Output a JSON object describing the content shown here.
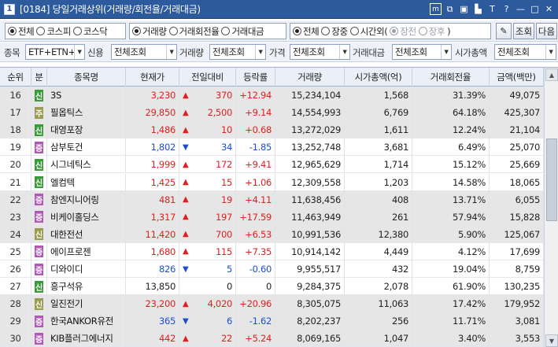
{
  "window": {
    "number": "1",
    "title": "[0184] 당일거래상위(거래량/회전율/거래대금)",
    "icons": [
      "m-icon",
      "restore-icon",
      "tile-icon",
      "pin-icon",
      "text-icon",
      "help-icon",
      "minimize-icon",
      "maximize-icon",
      "close-icon"
    ]
  },
  "filter1": {
    "market": {
      "options": [
        "전체",
        "코스피",
        "코스닥"
      ],
      "selected": 0
    },
    "sort": {
      "options": [
        "거래량",
        "거래회전율",
        "거래대금"
      ],
      "selected": 0
    },
    "session": {
      "options": [
        "전체",
        "장중",
        "시간외("
      ],
      "selected": 0
    },
    "after_hours": {
      "options": [
        "장전",
        "장후"
      ],
      "close_paren": ")",
      "selected": 0
    },
    "query_label": "조회",
    "next_label": "다음"
  },
  "filter2": {
    "item_label": "종목",
    "item_value": "ETF+ETN+스",
    "credit_label": "신용",
    "credit_value": "전체조회",
    "volume_label": "거래량",
    "volume_value": "전체조회",
    "price_label": "가격",
    "price_value": "전체조회",
    "amount_label": "거래대금",
    "amount_value": "전체조회",
    "cap_label": "시가총액",
    "cap_value": "전체조회"
  },
  "table": {
    "headers": {
      "rank": "순위",
      "type": "분",
      "name": "종목명",
      "price": "현재가",
      "change": "전일대비",
      "rate": "등락률",
      "volume": "거래량",
      "mktcap": "시가총액(억)",
      "turnover": "거래회전율",
      "amount": "금액(백만)"
    },
    "rows": [
      {
        "rank": "16",
        "badge": "신",
        "badge_color": "green",
        "name": "3S",
        "price": "3,230",
        "dir": "up",
        "change": "370",
        "rate": "+12.94",
        "volume": "15,234,104",
        "mktcap": "1,568",
        "turnover": "31.39%",
        "amount": "49,075",
        "shaded": true
      },
      {
        "rank": "17",
        "badge": "주",
        "badge_color": "olive",
        "name": "필옵틱스",
        "price": "29,850",
        "dir": "up",
        "change": "2,500",
        "rate": "+9.14",
        "volume": "14,554,993",
        "mktcap": "6,769",
        "turnover": "64.18%",
        "amount": "425,307",
        "shaded": true
      },
      {
        "rank": "18",
        "badge": "신",
        "badge_color": "green",
        "name": "대영포장",
        "price": "1,486",
        "dir": "up",
        "change": "10",
        "rate": "+0.68",
        "volume": "13,272,029",
        "mktcap": "1,611",
        "turnover": "12.24%",
        "amount": "21,104",
        "shaded": true
      },
      {
        "rank": "19",
        "badge": "증",
        "badge_color": "purple",
        "name": "삼부토건",
        "price": "1,802",
        "dir": "dn",
        "change": "34",
        "rate": "-1.85",
        "volume": "13,252,748",
        "mktcap": "3,681",
        "turnover": "6.49%",
        "amount": "25,070",
        "shaded": false
      },
      {
        "rank": "20",
        "badge": "신",
        "badge_color": "green",
        "name": "시그네틱스",
        "price": "1,999",
        "dir": "up",
        "change": "172",
        "rate": "+9.41",
        "volume": "12,965,629",
        "mktcap": "1,714",
        "turnover": "15.12%",
        "amount": "25,669",
        "shaded": false
      },
      {
        "rank": "21",
        "badge": "신",
        "badge_color": "green",
        "name": "엘컴텍",
        "price": "1,425",
        "dir": "up",
        "change": "15",
        "rate": "+1.06",
        "volume": "12,309,558",
        "mktcap": "1,203",
        "turnover": "14.58%",
        "amount": "18,065",
        "shaded": false
      },
      {
        "rank": "22",
        "badge": "증",
        "badge_color": "purple",
        "name": "참엔지니어링",
        "price": "481",
        "dir": "up",
        "change": "19",
        "rate": "+4.11",
        "volume": "11,638,456",
        "mktcap": "408",
        "turnover": "13.71%",
        "amount": "6,055",
        "shaded": true
      },
      {
        "rank": "23",
        "badge": "증",
        "badge_color": "purple",
        "name": "비케이홀딩스",
        "price": "1,317",
        "dir": "up",
        "change": "197",
        "rate": "+17.59",
        "volume": "11,463,949",
        "mktcap": "261",
        "turnover": "57.94%",
        "amount": "15,828",
        "shaded": true
      },
      {
        "rank": "24",
        "badge": "신",
        "badge_color": "olive",
        "name": "대한전선",
        "price": "11,420",
        "dir": "up",
        "change": "700",
        "rate": "+6.53",
        "volume": "10,991,536",
        "mktcap": "12,380",
        "turnover": "5.90%",
        "amount": "125,067",
        "shaded": true
      },
      {
        "rank": "25",
        "badge": "증",
        "badge_color": "purple",
        "name": "에이프로젠",
        "price": "1,680",
        "dir": "up",
        "change": "115",
        "rate": "+7.35",
        "volume": "10,914,142",
        "mktcap": "4,449",
        "turnover": "4.12%",
        "amount": "17,699",
        "shaded": false
      },
      {
        "rank": "26",
        "badge": "증",
        "badge_color": "purple",
        "name": "디와이디",
        "price": "826",
        "dir": "dn",
        "change": "5",
        "rate": "-0.60",
        "volume": "9,955,517",
        "mktcap": "432",
        "turnover": "19.04%",
        "amount": "8,759",
        "shaded": false
      },
      {
        "rank": "27",
        "badge": "신",
        "badge_color": "green",
        "name": "흥구석유",
        "price": "13,850",
        "dir": "none",
        "change": "0",
        "rate": "0",
        "volume": "9,284,375",
        "mktcap": "2,078",
        "turnover": "61.90%",
        "amount": "130,235",
        "shaded": false
      },
      {
        "rank": "28",
        "badge": "신",
        "badge_color": "olive",
        "name": "일진전기",
        "price": "23,200",
        "dir": "up",
        "change": "4,020",
        "rate": "+20.96",
        "volume": "8,305,075",
        "mktcap": "11,063",
        "turnover": "17.42%",
        "amount": "179,952",
        "shaded": true
      },
      {
        "rank": "29",
        "badge": "증",
        "badge_color": "purple",
        "name": "한국ANKOR유전",
        "price": "365",
        "dir": "dn",
        "change": "6",
        "rate": "-1.62",
        "volume": "8,202,237",
        "mktcap": "256",
        "turnover": "11.71%",
        "amount": "3,081",
        "shaded": true
      },
      {
        "rank": "30",
        "badge": "증",
        "badge_color": "purple",
        "name": "KIB플러그에너지",
        "price": "442",
        "dir": "up",
        "change": "22",
        "rate": "+5.24",
        "volume": "8,069,165",
        "mktcap": "1,047",
        "turnover": "3.40%",
        "amount": "3,553",
        "shaded": true
      }
    ]
  }
}
